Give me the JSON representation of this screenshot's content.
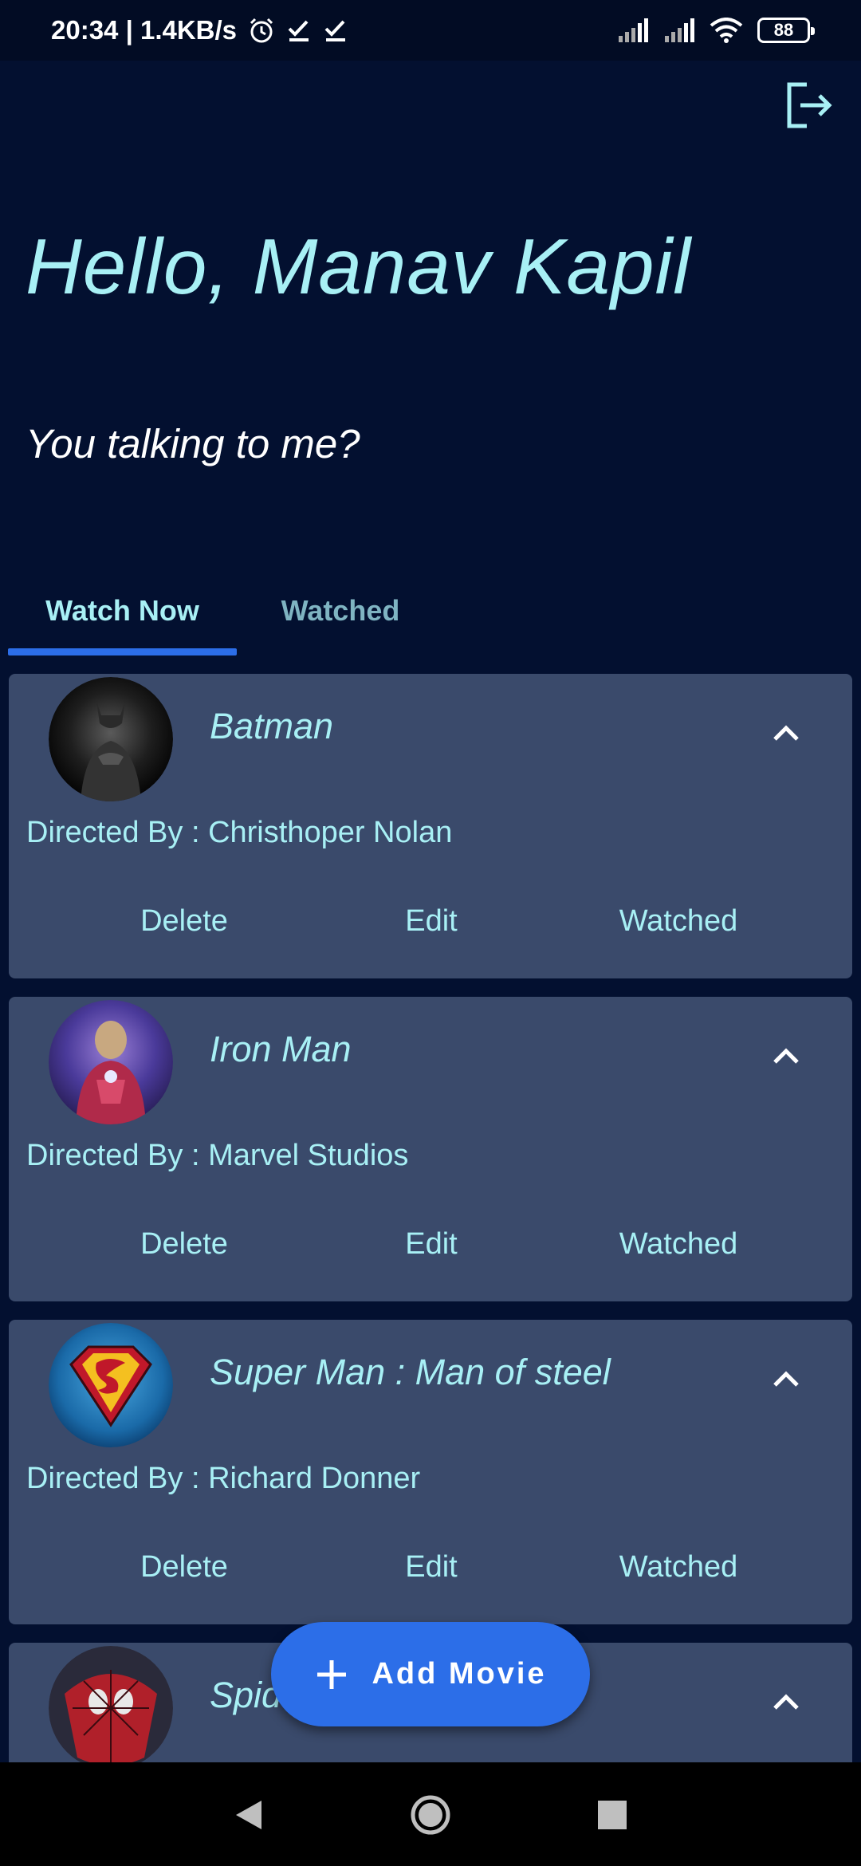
{
  "status_bar": {
    "time_speed": "20:34 | 1.4KB/s",
    "battery": "88",
    "icons": [
      "alarm-icon",
      "check-icon",
      "check-icon",
      "signal-icon",
      "signal-icon",
      "wifi-icon",
      "battery-icon"
    ]
  },
  "header": {
    "greeting": "Hello, Manav Kapil",
    "tagline": "You talking to me?",
    "logout_icon": "logout-icon"
  },
  "tabs": [
    {
      "label": "Watch Now",
      "selected": true
    },
    {
      "label": "Watched",
      "selected": false
    }
  ],
  "movies": [
    {
      "title": "Batman",
      "director": "Directed By : Christhoper Nolan",
      "actions": [
        "Delete",
        "Edit",
        "Watched"
      ]
    },
    {
      "title": "Iron Man",
      "director": "Directed By : Marvel Studios",
      "actions": [
        "Delete",
        "Edit",
        "Watched"
      ]
    },
    {
      "title": "Super Man : Man of steel",
      "director": "Directed By : Richard Donner",
      "actions": [
        "Delete",
        "Edit",
        "Watched"
      ]
    },
    {
      "title": "Spide"
    }
  ],
  "fab": {
    "label": "Add Movie",
    "icon": "plus-icon"
  },
  "nav": {
    "icons": [
      "back-icon",
      "home-icon",
      "recents-icon"
    ]
  },
  "colors": {
    "background": "#031030",
    "card": "#3a4a6b",
    "accent_text": "#a8f0f5",
    "primary": "#2c6ee8"
  }
}
